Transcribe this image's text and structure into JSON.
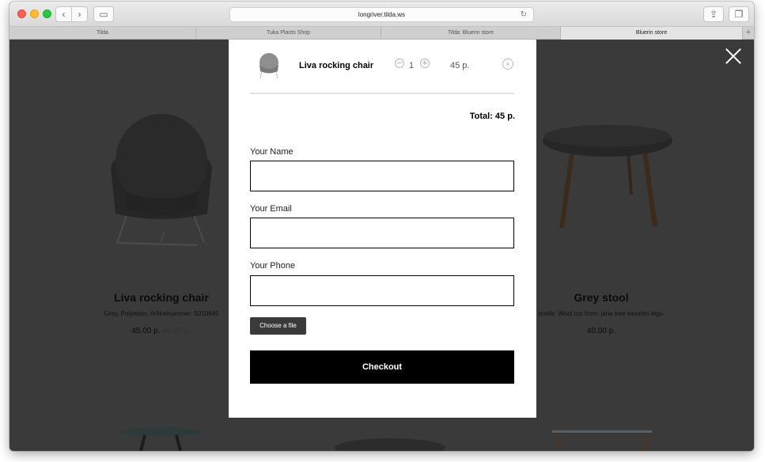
{
  "browser": {
    "url": "longriver.tilda.ws",
    "tabs": [
      {
        "label": "Tilda",
        "active": false
      },
      {
        "label": "Tuka Plants Shop",
        "active": false
      },
      {
        "label": "Tilda: Bluerin store",
        "active": false
      },
      {
        "label": "Bluerin store",
        "active": true
      }
    ],
    "back_glyph": "‹",
    "forward_glyph": "›",
    "sidebar_glyph": "▭",
    "share_glyph": "⇪",
    "tabs_glyph": "❐",
    "reload_glyph": "↻",
    "new_tab_glyph": "+"
  },
  "products": [
    {
      "title": "Liva rocking chair",
      "description": "Grey, Polyester. Artikelnummer: 5019645",
      "price": "45.00 p.",
      "old_price": "68.00 p."
    },
    {
      "title": "Grey stool",
      "description": "textile. Wool top from, pine tree wooden legs.",
      "price": "40.00 p."
    }
  ],
  "cart": {
    "item": {
      "name": "Liva rocking chair",
      "quantity": "1",
      "price": "45 p.",
      "minus_glyph": "−",
      "plus_glyph": "+",
      "remove_glyph": "×"
    },
    "total": "Total: 45 p.",
    "form": {
      "name_label": "Your Name",
      "email_label": "Your Email",
      "phone_label": "Your Phone",
      "file_button": "Choose a file",
      "checkout_button": "Checkout"
    }
  },
  "colors": {
    "overlay": "#3a3a3a",
    "accent": "#000000",
    "modal": "#ffffff"
  },
  "icons": {
    "close": "close-icon",
    "cart_item_thumbnail": "chair-icon"
  }
}
